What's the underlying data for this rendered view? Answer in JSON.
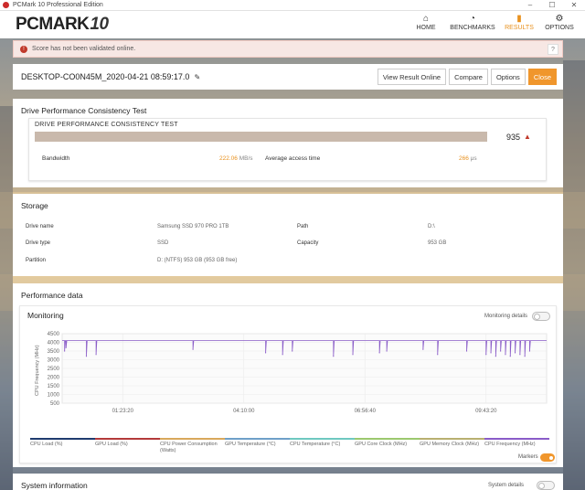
{
  "window": {
    "title": "PCMark 10 Professional Edition",
    "controls": [
      "–",
      "☐",
      "✕"
    ]
  },
  "app": {
    "logo_main": "PCMARK",
    "logo_num": "10"
  },
  "nav": [
    {
      "icon": "⌂",
      "label": "HOME",
      "active": false
    },
    {
      "icon": "◔",
      "label": "BENCHMARKS",
      "active": false
    },
    {
      "icon": "▮",
      "label": "RESULTS",
      "active": true
    },
    {
      "icon": "⚙",
      "label": "OPTIONS",
      "active": false
    }
  ],
  "warning": {
    "text": "Score has not been validated online.",
    "help": "?"
  },
  "result": {
    "name": "DESKTOP-CO0N45M_2020-04-21 08:59:17.0",
    "buttons": {
      "view_online": "View Result Online",
      "compare": "Compare",
      "options": "Options",
      "close": "Close"
    }
  },
  "dpc": {
    "heading": "Drive Performance Consistency Test",
    "card_title": "DRIVE PERFORMANCE CONSISTENCY TEST",
    "score": "935",
    "bandwidth_label": "Bandwidth",
    "bandwidth_value": "222.06",
    "bandwidth_unit": "MB/s",
    "access_label": "Average access time",
    "access_value": "266",
    "access_unit": "μs"
  },
  "storage": {
    "heading": "Storage",
    "drive_name_label": "Drive name",
    "drive_name": "Samsung SSD 970 PRO 1TB",
    "drive_type_label": "Drive type",
    "drive_type": "SSD",
    "partition_label": "Partition",
    "partition": "D: (NTFS) 953 GB (953 GB free)",
    "path_label": "Path",
    "path": "D:\\",
    "capacity_label": "Capacity",
    "capacity": "953 GB"
  },
  "performance": {
    "heading": "Performance data",
    "monitoring_title": "Monitoring",
    "monitoring_details": "Monitoring details",
    "markers_label": "Markers",
    "legend": [
      {
        "label": "CPU Load (%)",
        "color": "#1f3b6e"
      },
      {
        "label": "GPU Load (%)",
        "color": "#b33a3a"
      },
      {
        "label": "CPU Power Consumption (Watts)",
        "color": "#d8a85c"
      },
      {
        "label": "GPU Temperature (°C)",
        "color": "#6ea0c8"
      },
      {
        "label": "CPU Temperature (°C)",
        "color": "#6ec8c0"
      },
      {
        "label": "GPU Core Clock (MHz)",
        "color": "#9cc86e"
      },
      {
        "label": "GPU Memory Clock (MHz)",
        "color": "#b8b070"
      },
      {
        "label": "CPU Frequency (MHz)",
        "color": "#8a5cc8"
      }
    ]
  },
  "system_info": {
    "heading": "System information",
    "details": "System details"
  },
  "chart_data": {
    "type": "line",
    "ylabel": "CPU Frequency (MHz)",
    "ylim": [
      500,
      4500
    ],
    "yticks": [
      500,
      1000,
      1500,
      2000,
      2500,
      3000,
      3500,
      4000,
      4500
    ],
    "xticks": [
      "01:23:20",
      "04:10:00",
      "06:56:40",
      "09:43:20"
    ],
    "grid": true,
    "series": [
      {
        "name": "CPU Frequency (MHz)",
        "color": "#8a5cc8",
        "baseline": 4100,
        "dips": [
          {
            "t": 0.005,
            "v": 3500
          },
          {
            "t": 0.008,
            "v": 3700
          },
          {
            "t": 0.05,
            "v": 3200
          },
          {
            "t": 0.07,
            "v": 3300
          },
          {
            "t": 0.27,
            "v": 3600
          },
          {
            "t": 0.42,
            "v": 3400
          },
          {
            "t": 0.455,
            "v": 3300
          },
          {
            "t": 0.475,
            "v": 3500
          },
          {
            "t": 0.56,
            "v": 3200
          },
          {
            "t": 0.6,
            "v": 3300
          },
          {
            "t": 0.655,
            "v": 3400
          },
          {
            "t": 0.67,
            "v": 3500
          },
          {
            "t": 0.745,
            "v": 3600
          },
          {
            "t": 0.775,
            "v": 3300
          },
          {
            "t": 0.835,
            "v": 3500
          },
          {
            "t": 0.875,
            "v": 3300
          },
          {
            "t": 0.885,
            "v": 3400
          },
          {
            "t": 0.895,
            "v": 3200
          },
          {
            "t": 0.905,
            "v": 3500
          },
          {
            "t": 0.915,
            "v": 3300
          },
          {
            "t": 0.925,
            "v": 3200
          },
          {
            "t": 0.935,
            "v": 3400
          },
          {
            "t": 0.945,
            "v": 3300
          },
          {
            "t": 0.955,
            "v": 3200
          },
          {
            "t": 0.965,
            "v": 3500
          }
        ]
      }
    ]
  }
}
